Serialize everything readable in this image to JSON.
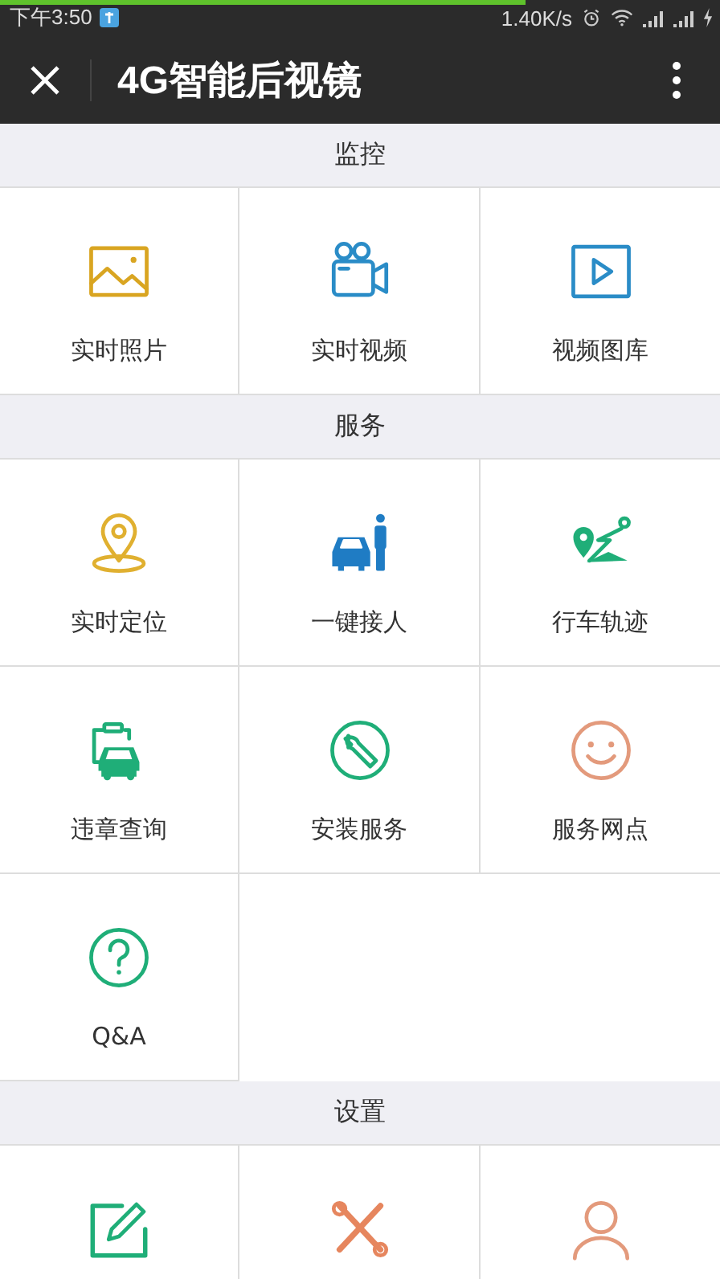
{
  "progress_bar": {
    "level": 0.73
  },
  "status_bar": {
    "time": "下午3:50",
    "speed": "1.40K/s"
  },
  "title_bar": {
    "title": "4G智能后视镜"
  },
  "sections": [
    {
      "title": "监控",
      "items": [
        {
          "kind": "photo",
          "color": "#d9a521",
          "label": "实时照片"
        },
        {
          "kind": "camera",
          "color": "#2a8cc7",
          "label": "实时视频"
        },
        {
          "kind": "play",
          "color": "#2a8cc7",
          "label": "视频图库"
        }
      ]
    },
    {
      "title": "服务",
      "items": [
        {
          "kind": "pin",
          "color": "#e0b030",
          "label": "实时定位"
        },
        {
          "kind": "pickup",
          "color": "#1f7cc4",
          "label": "一键接人"
        },
        {
          "kind": "route",
          "color": "#1fae78",
          "label": "行车轨迹"
        },
        {
          "kind": "ticket",
          "color": "#1fae78",
          "label": "违章查询"
        },
        {
          "kind": "wrench",
          "color": "#1fae78",
          "label": "安装服务"
        },
        {
          "kind": "smile",
          "color": "#e39a7c",
          "label": "服务网点"
        },
        {
          "kind": "help",
          "color": "#1fae78",
          "label": "Q&A"
        }
      ]
    },
    {
      "title": "设置",
      "items": [
        {
          "kind": "edit",
          "color": "#1fae78"
        },
        {
          "kind": "tools",
          "color": "#e6865e"
        },
        {
          "kind": "user",
          "color": "#e39a7c"
        }
      ]
    }
  ]
}
